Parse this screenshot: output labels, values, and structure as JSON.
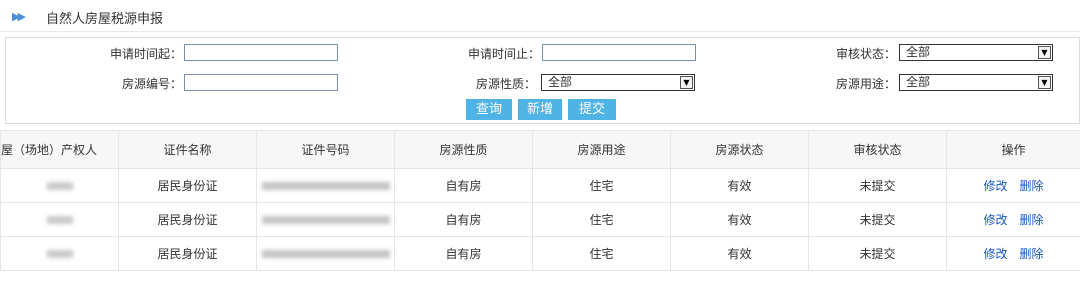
{
  "page": {
    "title": "自然人房屋税源申报"
  },
  "filters": {
    "apply_time_start_label": "申请时间起：",
    "apply_time_end_label": "申请时间止：",
    "audit_status_label": "审核状态：",
    "audit_status_value": "全部",
    "house_no_label": "房源编号：",
    "house_nature_label": "房源性质：",
    "house_nature_value": "全部",
    "house_use_label": "房源用途：",
    "house_use_value": "全部"
  },
  "buttons": {
    "query": "查询",
    "add": "新增",
    "submit": "提交"
  },
  "table": {
    "headers": [
      "屋（场地）产权人",
      "证件名称",
      "证件号码",
      "房源性质",
      "房源用途",
      "房源状态",
      "审核状态",
      "操作"
    ],
    "rows": [
      {
        "cert_name": "居民身份证",
        "nature": "自有房",
        "use": "住宅",
        "status": "有效",
        "audit": "未提交",
        "edit": "修改",
        "delete": "删除"
      },
      {
        "cert_name": "居民身份证",
        "nature": "自有房",
        "use": "住宅",
        "status": "有效",
        "audit": "未提交",
        "edit": "修改",
        "delete": "删除"
      },
      {
        "cert_name": "居民身份证",
        "nature": "自有房",
        "use": "住宅",
        "status": "有效",
        "audit": "未提交",
        "edit": "修改",
        "delete": "删除"
      }
    ]
  }
}
